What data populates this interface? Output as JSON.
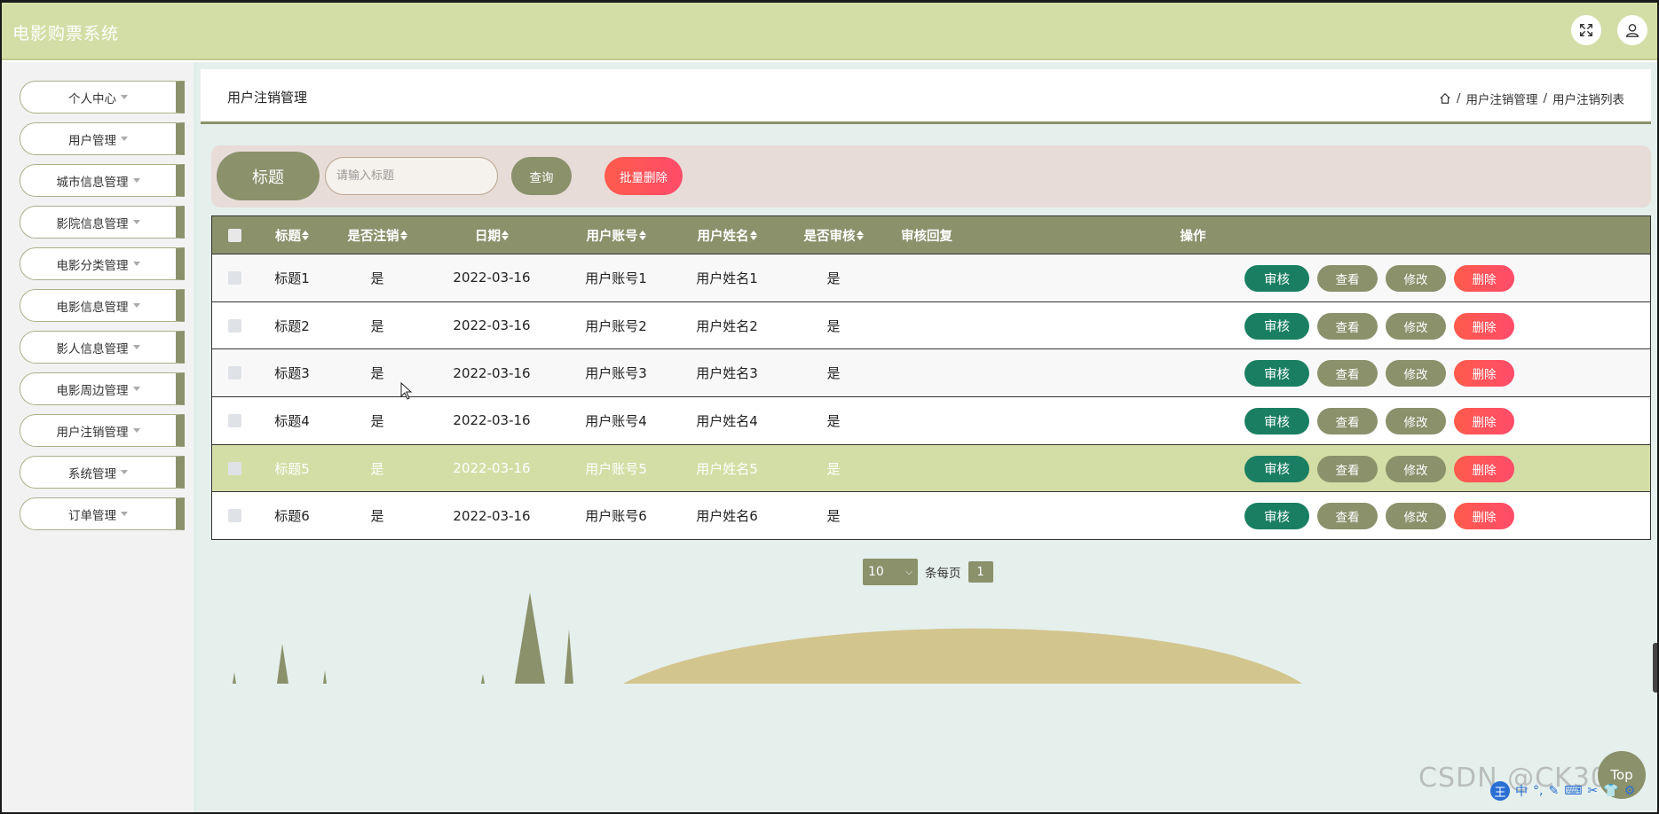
{
  "app": {
    "title": "电影购票系统"
  },
  "header": {
    "fullscreen_icon": "fullscreen-icon",
    "user_icon": "user-icon"
  },
  "sidebar": {
    "items": [
      {
        "label": "个人中心"
      },
      {
        "label": "用户管理"
      },
      {
        "label": "城市信息管理"
      },
      {
        "label": "影院信息管理"
      },
      {
        "label": "电影分类管理"
      },
      {
        "label": "电影信息管理"
      },
      {
        "label": "影人信息管理"
      },
      {
        "label": "电影周边管理"
      },
      {
        "label": "用户注销管理"
      },
      {
        "label": "系统管理"
      },
      {
        "label": "订单管理"
      }
    ]
  },
  "page": {
    "title": "用户注销管理",
    "breadcrumb": [
      "用户注销管理",
      "用户注销列表"
    ],
    "breadcrumb_sep": "/"
  },
  "search": {
    "label": "标题",
    "placeholder": "请输入标题",
    "query_label": "查询",
    "batch_delete_label": "批量删除"
  },
  "table": {
    "columns": [
      "标题",
      "是否注销",
      "日期",
      "用户账号",
      "用户姓名",
      "是否审核",
      "审核回复",
      "操作"
    ],
    "rows": [
      {
        "title": "标题1",
        "cancelled": "是",
        "date": "2022-03-16",
        "account": "用户账号1",
        "name": "用户姓名1",
        "reviewed": "是",
        "reply": ""
      },
      {
        "title": "标题2",
        "cancelled": "是",
        "date": "2022-03-16",
        "account": "用户账号2",
        "name": "用户姓名2",
        "reviewed": "是",
        "reply": ""
      },
      {
        "title": "标题3",
        "cancelled": "是",
        "date": "2022-03-16",
        "account": "用户账号3",
        "name": "用户姓名3",
        "reviewed": "是",
        "reply": ""
      },
      {
        "title": "标题4",
        "cancelled": "是",
        "date": "2022-03-16",
        "account": "用户账号4",
        "name": "用户姓名4",
        "reviewed": "是",
        "reply": ""
      },
      {
        "title": "标题5",
        "cancelled": "是",
        "date": "2022-03-16",
        "account": "用户账号5",
        "name": "用户姓名5",
        "reviewed": "是",
        "reply": ""
      },
      {
        "title": "标题6",
        "cancelled": "是",
        "date": "2022-03-16",
        "account": "用户账号6",
        "name": "用户姓名6",
        "reviewed": "是",
        "reply": ""
      }
    ],
    "highlighted_row": 5,
    "actions": {
      "review": "审核",
      "view": "查看",
      "edit": "修改",
      "delete": "删除"
    }
  },
  "pager": {
    "page_size": "10",
    "per_page_label": "条每页",
    "current_page": "1"
  },
  "misc": {
    "top_label": "Top",
    "watermark": "CSDN @CK3084",
    "ime": [
      "王",
      "中",
      "°,",
      "✎",
      "⌨",
      "✂",
      "👕",
      "⚙"
    ]
  },
  "colors": {
    "header_bg": "#d3dea6",
    "accent": "#8a916b",
    "review_green": "#1a7f62",
    "delete_red": "#ff5b4c",
    "search_panel_bg": "#e8dcd8",
    "main_bg": "#e5efec"
  }
}
